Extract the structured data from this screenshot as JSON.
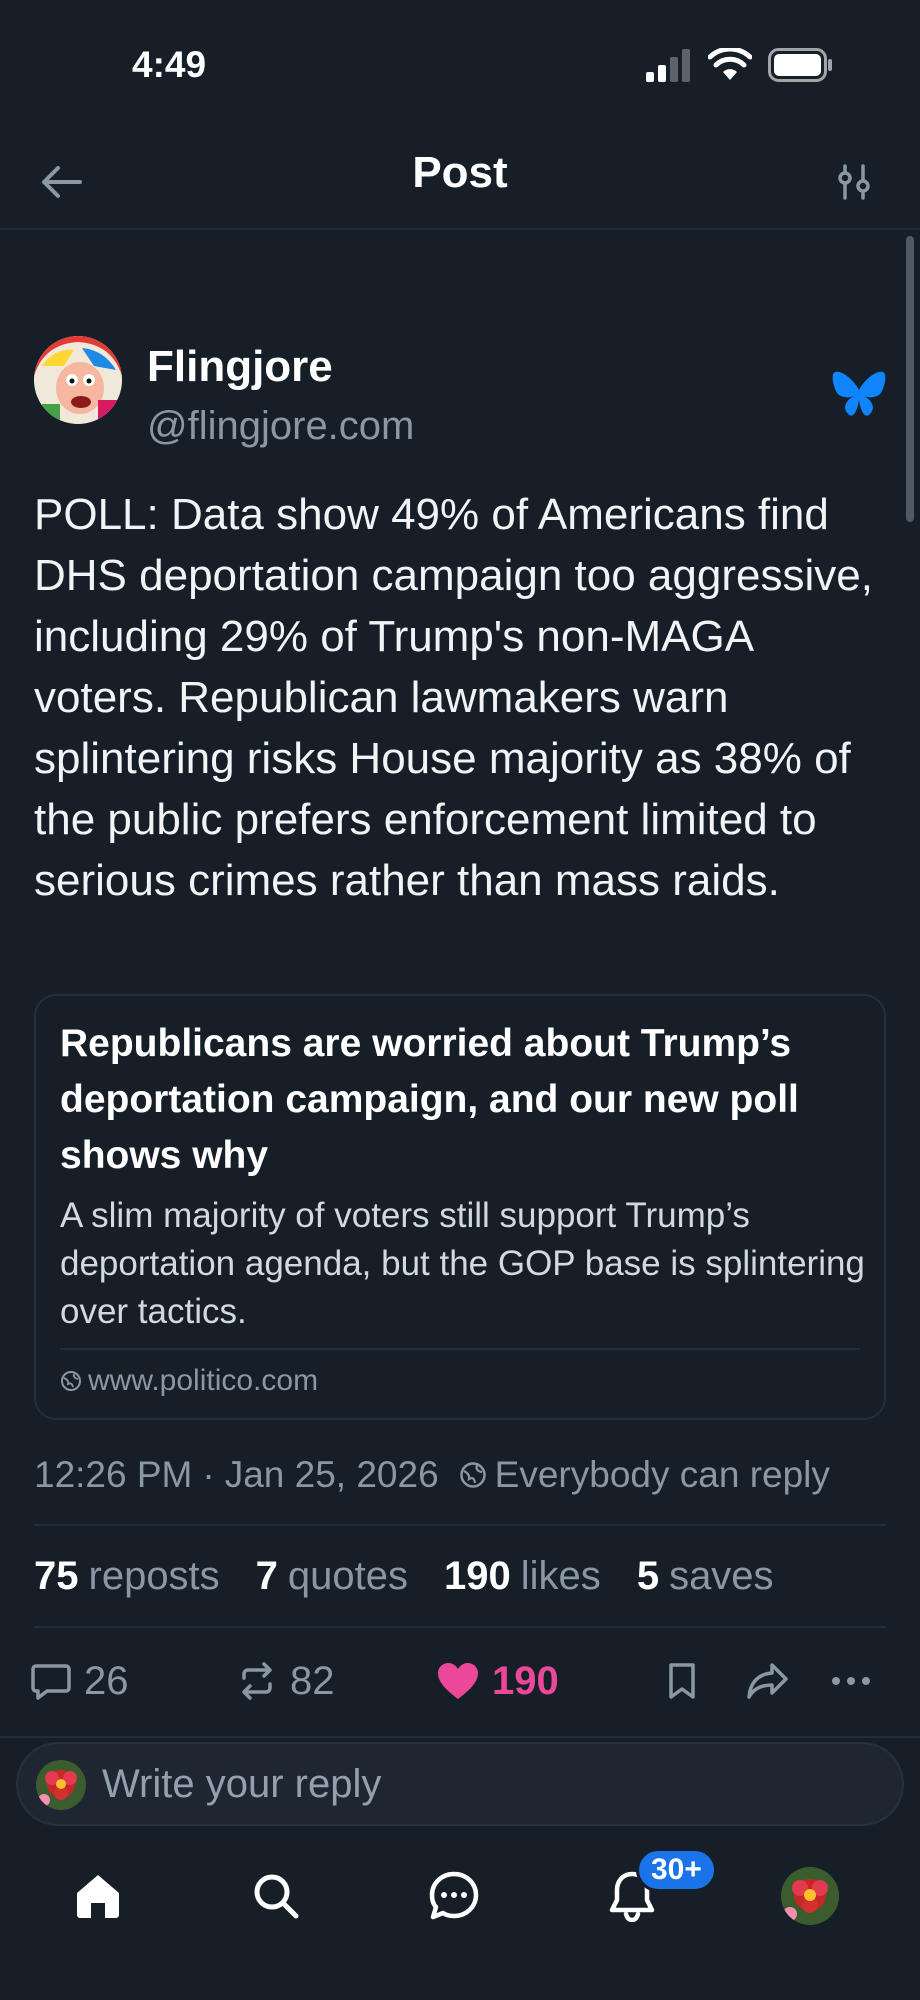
{
  "status_bar": {
    "time": "4:49"
  },
  "header": {
    "title": "Post"
  },
  "post": {
    "author_name": "Flingjore",
    "author_handle": "@flingjore.com",
    "text": "POLL: Data show 49% of Americans find DHS deportation campaign too aggressive, including 29% of Trump's non-MAGA voters. Republican lawmakers warn splintering risks House majority as 38% of the public prefers enforcement limited to serious crimes rather than mass raids.",
    "link_card": {
      "title": "Republicans are worried about Trump’s deportation campaign, and our new poll shows why",
      "description": "A slim majority of voters still support Trump’s deportation agenda, but the GOP base is splintering over tactics.",
      "domain": "www.politico.com"
    },
    "time": "12:26 PM",
    "date": "Jan 25, 2026",
    "reply_permission": "Everybody can reply",
    "stats": {
      "reposts_count": "75",
      "reposts_label": "reposts",
      "quotes_count": "7",
      "quotes_label": "quotes",
      "likes_count": "190",
      "likes_label": "likes",
      "saves_count": "5",
      "saves_label": "saves"
    },
    "actions": {
      "replies": "26",
      "reposts": "82",
      "likes": "190"
    }
  },
  "reply_bar": {
    "placeholder": "Write your reply"
  },
  "tabbar": {
    "notifications_badge": "30+"
  },
  "colors": {
    "background": "#161e27",
    "like": "#ec4899",
    "brand": "#1185fe",
    "badge": "#1a73e8"
  }
}
